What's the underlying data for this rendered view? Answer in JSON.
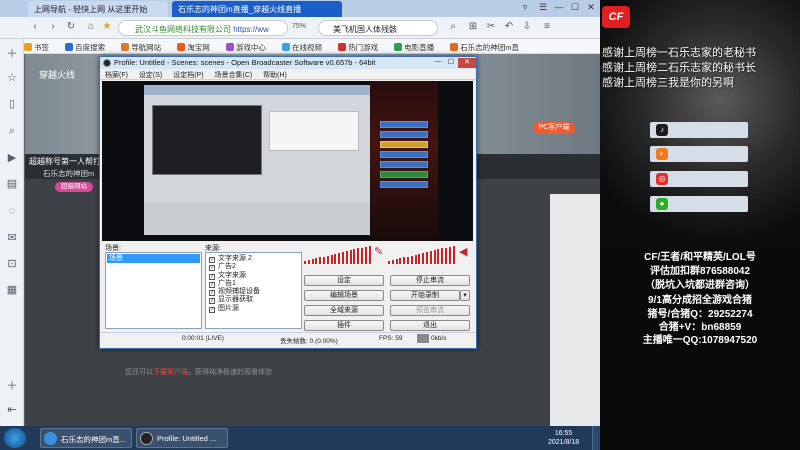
{
  "browser": {
    "tabs": [
      {
        "label": "上网导航 - 轻快上网 从这里开始"
      },
      {
        "label": "石乐志的神团m直播_穿越火线直播"
      }
    ],
    "window_controls": [
      "▿",
      "☰",
      "—",
      "☐",
      "✕"
    ],
    "address": {
      "secure_text": "武汉斗鱼网络科技有限公司",
      "url": "https://ww"
    },
    "zoom": "75%",
    "search_value": "美飞机国人体残骸",
    "bookmarks": [
      "书签",
      "百度搜索",
      "导航网站",
      "淘宝网",
      "游戏中心",
      "在线视频",
      "热门游戏",
      "电影直播",
      "石乐志的神团m直"
    ]
  },
  "page": {
    "tag": "穿越火线",
    "room_line": "超越称号第一人帮打订",
    "anchor_name": "石乐志的神团m",
    "tag_pill": "超级网站",
    "follow_button": "PC客户端",
    "footnote_prefix": "您还可以",
    "footnote_link": "下载客户端",
    "footnote_suffix": "，获得纯净极速的观看体验"
  },
  "obs": {
    "title": "Profile: Untitled - Scenes: scenes - Open Broadcaster Software v0.657b - 64bit",
    "menu": [
      "档案(F)",
      "设定(S)",
      "设定档(P)",
      "场景合集(C)",
      "帮助(H)"
    ],
    "scenes_label": "场景:",
    "sources_label": "来源:",
    "scenes": [
      "场景"
    ],
    "sources": [
      "文字来源 2",
      "广告2",
      "文字来源",
      "广告1",
      "视频捕捉设备",
      "显示器获取",
      "图片源"
    ],
    "buttons": {
      "settings": "设定",
      "stop_preview": "停止串流",
      "edit_scene": "编辑场景",
      "start_recording": "开始录制",
      "global_sources": "全域来源",
      "record_preview": "预览串流",
      "plugins": "插件",
      "exit": "退出"
    },
    "status": {
      "time": "0:00:01 (LIVE)",
      "dropped": "丢失帧数: 0 (0.00%)",
      "fps": "FPS: 59",
      "kbps": "0kb/s"
    }
  },
  "overlay": {
    "logo": "CF",
    "thanks": [
      "感谢上周榜一石乐志家的老秘书",
      "感谢上周榜二石乐志家的秘书长",
      "感谢上周榜三我是你的另啊"
    ],
    "socials": [
      {
        "icon": "tiktok-icon",
        "color": "#1b1b1b",
        "glyph": "♪"
      },
      {
        "icon": "kuaishou-icon",
        "color": "#f07a1e",
        "glyph": "◐"
      },
      {
        "icon": "weibo-icon",
        "color": "#e03030",
        "glyph": "◎"
      },
      {
        "icon": "wechat-icon",
        "color": "#2aae2a",
        "glyph": "●"
      }
    ],
    "info": [
      "CF/王者/和平精英/LOL号",
      "评估加扣群876588042",
      "（脱坑入坑都进群咨询）",
      "9/1高分成招全游戏合猪",
      "猪号/合猪Q：29252274",
      "合猪+V：bn68859",
      "主播唯一QQ:1078947520"
    ]
  },
  "taskbar": {
    "items": [
      "石乐志的神团m直...",
      "Profile: Untitled ..."
    ],
    "time": "16:55",
    "date": "2021/8/18"
  },
  "colors": {
    "accent": "#1a5fc8",
    "obs_meter": "#c9232a",
    "overlay_text": "#ffffff"
  }
}
